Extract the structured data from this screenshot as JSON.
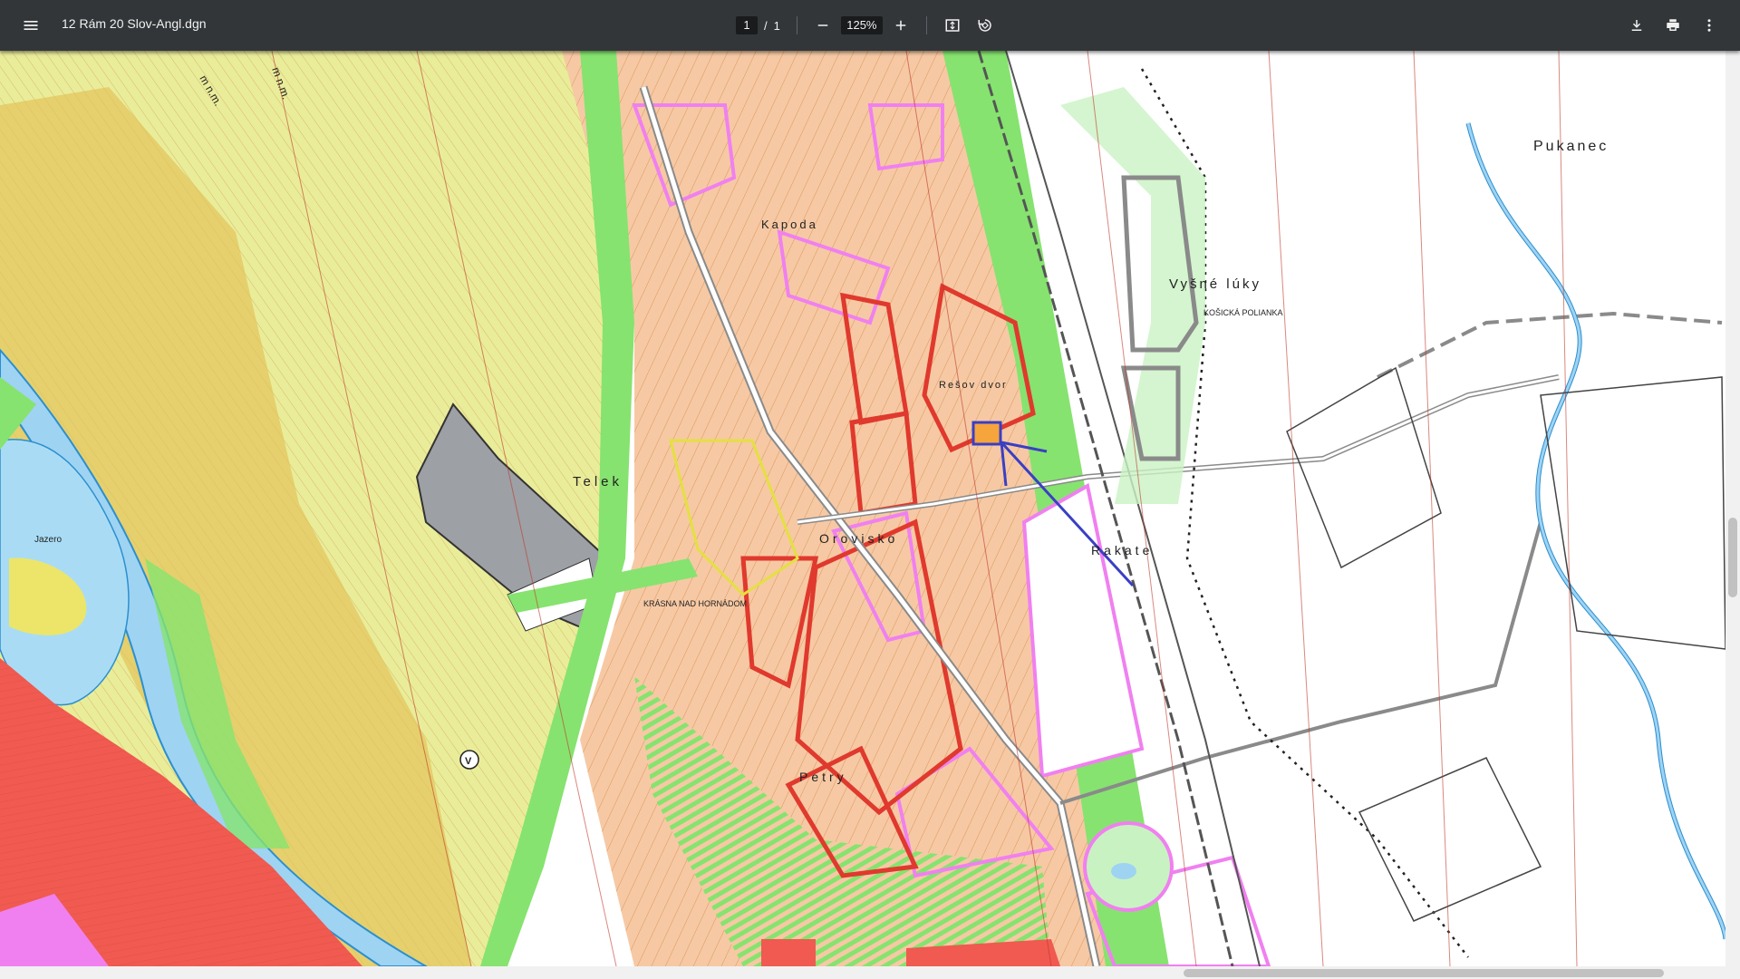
{
  "toolbar": {
    "title": "12 Rám 20 Slov-Angl.dgn",
    "page_current": "1",
    "page_sep": "/",
    "page_total": "1",
    "zoom": "125%",
    "icons": {
      "menu": "menu-icon",
      "zoom_out": "minus-icon",
      "zoom_in": "plus-icon",
      "fit": "fit-page-icon",
      "rotate": "rotate-icon",
      "download": "download-icon",
      "print": "print-icon",
      "more": "more-vert-icon"
    }
  },
  "map": {
    "labels": {
      "pukanec": "Pukanec",
      "vysne_luky": "Vyšné lúky",
      "kosicka_polianka": "KOŠICKÁ POLIANKA",
      "resov_dvor": "Rešov dvor",
      "telek": "Telek",
      "orovisko": "Orovisko",
      "rakate": "Rakate",
      "krasna": "KRÁSNA NAD HORNÁDOM",
      "petry": "Petry",
      "jazero": "Jazero",
      "kapoda": "Kapoda",
      "m_nm_1": "m n.m.",
      "m_nm_2": "m n.m.",
      "road_v": "V"
    },
    "colors": {
      "orange_zone": "#f6c9a4",
      "green_zone": "#86e36f",
      "red_zone": "#f05a50",
      "magenta_zone": "#f080f0",
      "yellow_zone": "#e7e35a",
      "water": "#9fd3f2",
      "contour": "#c8712a",
      "annotation": "#3a3fc4"
    }
  }
}
